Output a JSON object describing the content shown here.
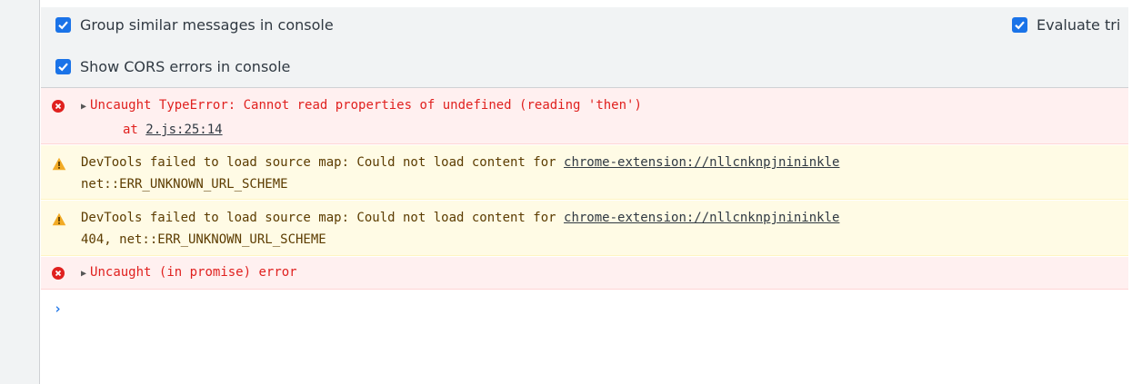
{
  "settings": {
    "group_similar": "Group similar messages in console",
    "show_cors": "Show CORS errors in console",
    "evaluate_triggers": "Evaluate tri"
  },
  "messages": [
    {
      "type": "error",
      "line1": "Uncaught TypeError: Cannot read properties of undefined (reading 'then')",
      "line2_prefix": "at ",
      "line2_link": "2.js:25:14"
    },
    {
      "type": "warning",
      "line1_text": "DevTools failed to load source map: Could not load content for ",
      "line1_link": "chrome-extension://nllcnknpjnininkle",
      "line2": "net::ERR_UNKNOWN_URL_SCHEME"
    },
    {
      "type": "warning",
      "line1_text": "DevTools failed to load source map: Could not load content for ",
      "line1_link": "chrome-extension://nllcnknpjnininkle",
      "line2": "404, net::ERR_UNKNOWN_URL_SCHEME"
    },
    {
      "type": "error",
      "line1": "Uncaught (in promise) error"
    }
  ],
  "prompt_symbol": "›",
  "colors": {
    "checkbox": "#1a73e8",
    "error_text": "#e0211f",
    "error_bg": "#fff0f0",
    "warning_bg": "#fffbe5",
    "warning_icon": "#f2ab26"
  }
}
